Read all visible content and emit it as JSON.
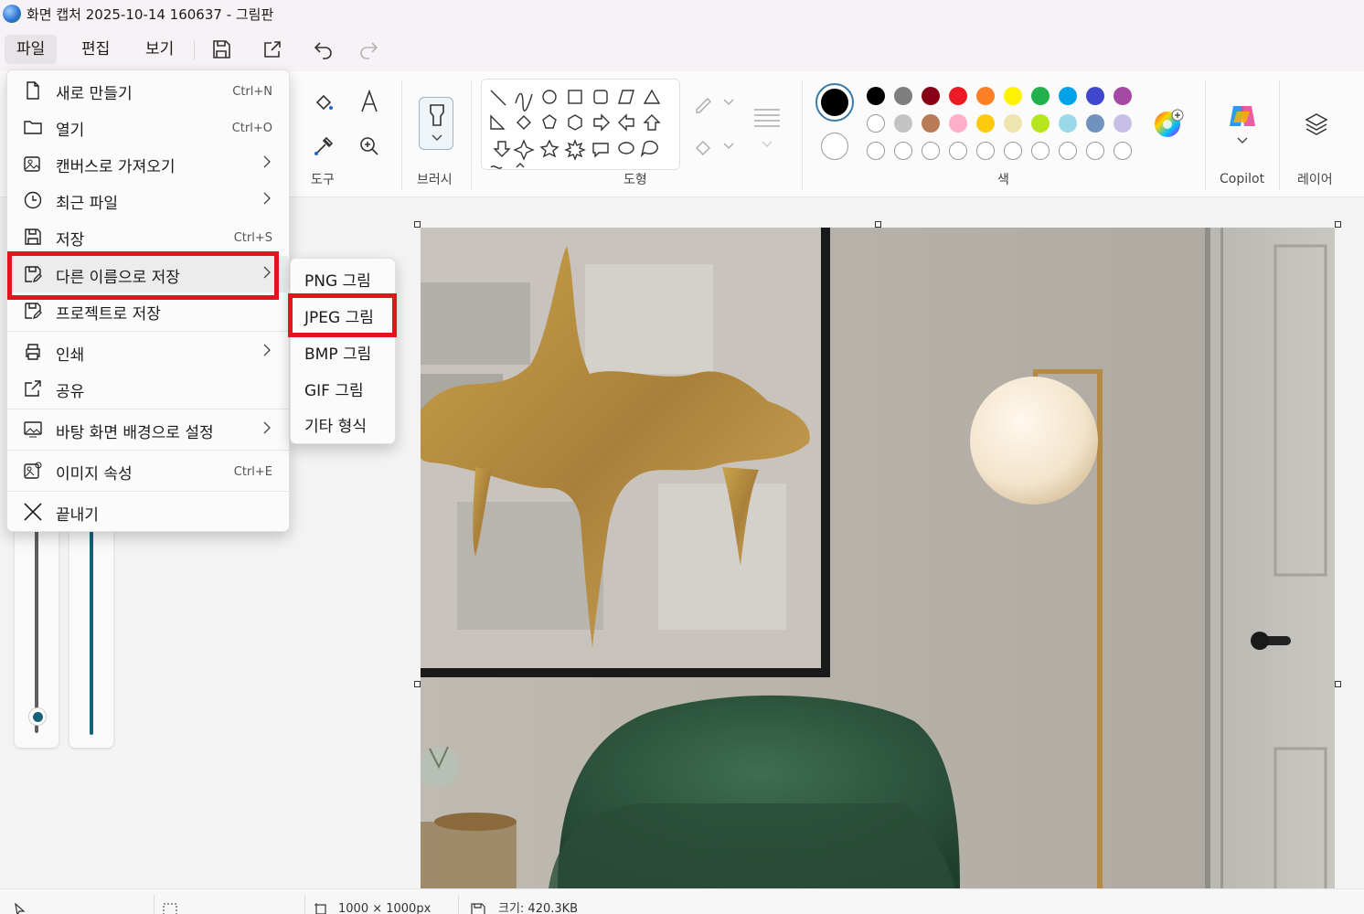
{
  "window": {
    "title": "화면 캡처 2025-10-14 160637 - 그림판"
  },
  "menubar": {
    "file": "파일",
    "edit": "편집",
    "view": "보기",
    "save_icon": "save-icon",
    "share_icon": "share-icon",
    "undo_icon": "undo-icon",
    "redo_icon": "redo-icon"
  },
  "ribbon": {
    "tools_label": "도구",
    "brush_label": "브러시",
    "shapes_label": "도형",
    "colors_label": "색",
    "copilot_label": "Copilot",
    "layers_label": "레이어",
    "colors": {
      "row1": [
        "#000000",
        "#7f7f7f",
        "#880015",
        "#ed1c24",
        "#ff7f27",
        "#fff200",
        "#22b14c",
        "#00a2e8",
        "#3f48cc",
        "#a349a4"
      ],
      "row2": [
        "#ffffff",
        "#c3c3c3",
        "#b97a57",
        "#ffaec9",
        "#ffc90e",
        "#efe4b0",
        "#b5e61d",
        "#99d9ea",
        "#7092be",
        "#c8bfe7"
      ],
      "primary": "#000000",
      "secondary": "#ffffff"
    }
  },
  "file_menu": {
    "items": [
      {
        "label": "새로 만들기",
        "shortcut": "Ctrl+N",
        "icon": "new-file-icon"
      },
      {
        "label": "열기",
        "shortcut": "Ctrl+O",
        "icon": "folder-icon"
      },
      {
        "label": "캔버스로 가져오기",
        "shortcut": "",
        "icon": "import-image-icon"
      },
      {
        "label": "최근 파일",
        "shortcut": "",
        "icon": "clock-icon"
      },
      {
        "label": "저장",
        "shortcut": "Ctrl+S",
        "icon": "save-icon"
      },
      {
        "label": "다른 이름으로 저장",
        "shortcut": "",
        "icon": "save-as-icon"
      },
      {
        "label": "프로젝트로 저장",
        "shortcut": "",
        "icon": "save-project-icon"
      },
      {
        "label": "인쇄",
        "shortcut": "",
        "icon": "print-icon"
      },
      {
        "label": "공유",
        "shortcut": "",
        "icon": "share-icon"
      },
      {
        "label": "바탕 화면 배경으로 설정",
        "shortcut": "",
        "icon": "wallpaper-icon"
      },
      {
        "label": "이미지 속성",
        "shortcut": "Ctrl+E",
        "icon": "image-properties-icon"
      },
      {
        "label": "끝내기",
        "shortcut": "",
        "icon": "close-icon"
      }
    ]
  },
  "save_as_submenu": {
    "items": [
      "PNG 그림",
      "JPEG 그림",
      "BMP 그림",
      "GIF 그림",
      "기타 형식"
    ]
  },
  "statusbar": {
    "canvas_size": "1000 × 1000px",
    "file_size": "크기: 420.3KB"
  }
}
